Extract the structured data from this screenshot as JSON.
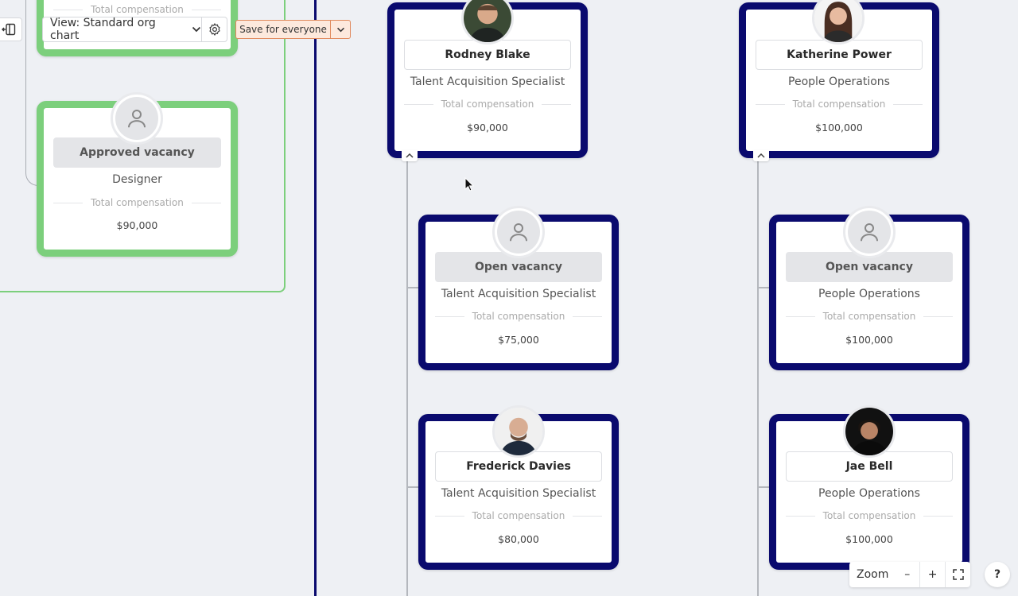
{
  "toolbar": {
    "view_label": "View: Standard org chart",
    "save_label": "Save for everyone"
  },
  "zoom": {
    "label": "Zoom",
    "minus": "–",
    "plus": "+"
  },
  "help": {
    "label": "?"
  },
  "cards": {
    "top_left_partial": {
      "comp_label": "Total compensation"
    },
    "approved_vacancy": {
      "name": "Approved vacancy",
      "role": "Designer",
      "comp_label": "Total compensation",
      "comp_value": "$90,000"
    },
    "rodney": {
      "name": "Rodney Blake",
      "role": "Talent Acquisition Specialist",
      "comp_label": "Total compensation",
      "comp_value": "$90,000"
    },
    "katherine": {
      "name": "Katherine Power",
      "role": "People Operations",
      "comp_label": "Total compensation",
      "comp_value": "$100,000"
    },
    "open_tas": {
      "name": "Open vacancy",
      "role": "Talent Acquisition Specialist",
      "comp_label": "Total compensation",
      "comp_value": "$75,000"
    },
    "open_po": {
      "name": "Open vacancy",
      "role": "People Operations",
      "comp_label": "Total compensation",
      "comp_value": "$100,000"
    },
    "frederick": {
      "name": "Frederick Davies",
      "role": "Talent Acquisition Specialist",
      "comp_label": "Total compensation",
      "comp_value": "$80,000"
    },
    "jae": {
      "name": "Jae Bell",
      "role": "People Operations",
      "comp_label": "Total compensation",
      "comp_value": "$100,000"
    }
  },
  "colors": {
    "approved_border": "#7ccf7c",
    "team_border": "#0a0a6e",
    "save_bg": "#fde9dd",
    "save_border": "#e0895c"
  },
  "icons": [
    "sidebar-collapse-icon",
    "chevron-down-icon",
    "gear-icon",
    "person-placeholder-icon",
    "chevron-up-icon",
    "fullscreen-icon",
    "cursor-arrow-icon"
  ]
}
